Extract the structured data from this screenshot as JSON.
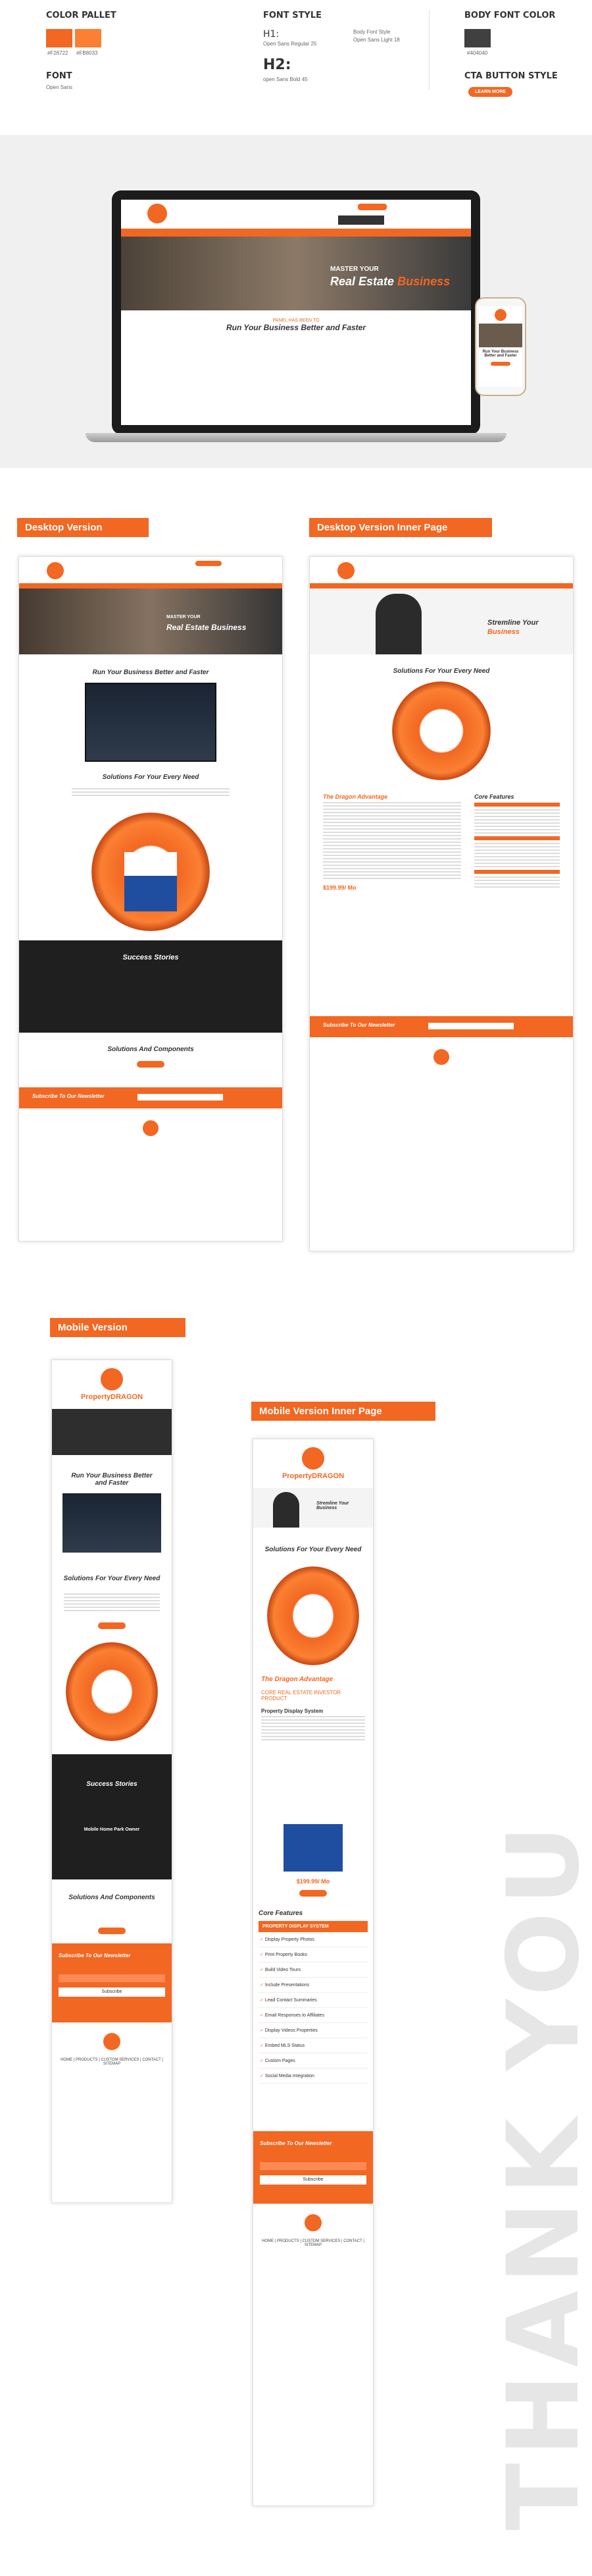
{
  "style_guide": {
    "color_pallet_title": "COLOR PALLET",
    "colors": [
      {
        "hex": "#F26722",
        "label": "#F26722"
      },
      {
        "hex": "#FB8033",
        "label": "#FB8033"
      }
    ],
    "font_title": "FONT",
    "font_name": "Open Sans",
    "font_style_title": "FONT STYLE",
    "h1_label": "H1:",
    "h1_desc": "Open Sans Regular 25",
    "h2_label": "H2:",
    "h2_desc": "open Sans Bold 45",
    "body_font_style_label": "Body Font Style",
    "body_font_style_desc": "Open Sans Light 18",
    "body_font_color_title": "BODY FONT COLOR",
    "body_color_hex": "#404040",
    "body_color_label": "#404040",
    "cta_title": "CTA BUTTON STYLE",
    "cta_label": "LEARN MORE"
  },
  "hero": {
    "laptop_heading_small": "MASTER YOUR",
    "laptop_heading_large_1": "Real Estate",
    "laptop_heading_large_2": "Business",
    "laptop_tagline_small": "PANEL HAS BEEN TO",
    "laptop_tagline": "Run Your Business Better and Faster",
    "phone_tagline": "Run Your Business Better and Faster"
  },
  "sections": {
    "desktop": "Desktop Version",
    "desktop_inner": "Desktop Version Inner Page",
    "mobile": "Mobile Version",
    "mobile_inner": "Mobile Version Inner Page"
  },
  "desktop_page": {
    "hero_small": "MASTER YOUR",
    "hero_big": "Real Estate Business",
    "run": "Run Your Business Better and Faster",
    "solutions": "Solutions For Your Every Need",
    "success": "Success Stories",
    "components": "Solutions And Components",
    "newsletter": "Subscribe To Our Newsletter"
  },
  "inner_page": {
    "hero_line": "Stremline Your",
    "hero_line2": "Business",
    "solutions": "Solutions For Your Every Need",
    "advantage": "The Dragon Advantage",
    "core": "Core Features",
    "price": "$199.99/ Mo",
    "newsletter": "Subscribe To Our Newsletter"
  },
  "mobile_page": {
    "brand": "PropertyDRAGON",
    "run": "Run Your Business Better and Faster",
    "solutions": "Solutions For Your Every Need",
    "success": "Success Stories",
    "success_sub": "Mobile Home Park Owner",
    "components": "Solutions And Components",
    "newsletter": "Subscribe To Our Newsletter",
    "subscribe_btn": "Subscribe",
    "footer_links": "HOME  |  PRODUCTS  |  CUSTOM SERVICES  |  CONTACT  |  SITEMAP"
  },
  "mobile_inner_page": {
    "brand": "PropertyDRAGON",
    "hero": "Stremline Your Business",
    "solutions": "Solutions For Your Every Need",
    "advantage": "The Dragon Advantage",
    "core_product": "CORE REAL ESTATE INVESTOR PRODUCT",
    "display": "Property Display System",
    "price": "$199.99/ Mo",
    "core": "Core Features",
    "features_header": "PROPERTY DISPLAY SYSTEM",
    "features": [
      "Display Property Photos",
      "Print Property Books",
      "Build Video Tours",
      "Include Presentations",
      "Lead Contact Summaries",
      "Email Responses to Affiliates",
      "Display Videos Properties",
      "Embed MLS Status",
      "Custom Pages",
      "Social Media Integration"
    ],
    "newsletter": "Subscribe To Our Newsletter",
    "subscribe_btn": "Subscribe",
    "footer_links": "HOME  |  PRODUCTS  |  CUSTOM SERVICES  |  CONTACT  |  SITEMAP"
  },
  "thank_you": "THANK YOU"
}
